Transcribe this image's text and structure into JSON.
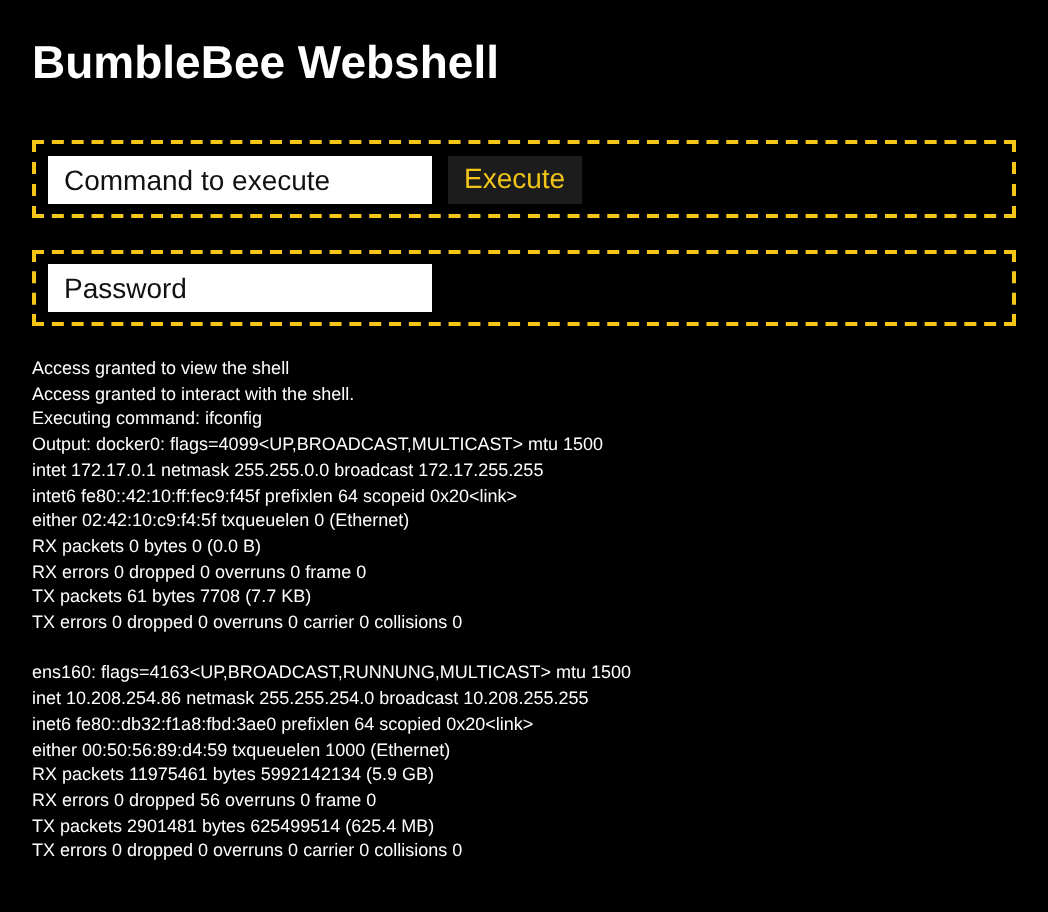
{
  "title": "BumbleBee Webshell",
  "command_form": {
    "input": {
      "placeholder": "Command to execute"
    },
    "button": "Execute"
  },
  "password_form": {
    "input": {
      "placeholder": "Password"
    }
  },
  "output": [
    [
      "Access granted to view the shell",
      "Access granted to interact with the shell.",
      "Executing command: ifconfig",
      "Output: docker0: flags=4099<UP,BROADCAST,MULTICAST> mtu 1500",
      "intet 172.17.0.1 netmask 255.255.0.0 broadcast 172.17.255.255",
      "intet6 fe80::42:10:ff:fec9:f45f prefixlen 64 scopeid 0x20<link>",
      "either 02:42:10:c9:f4:5f txqueuelen 0 (Ethernet)",
      "RX packets 0 bytes 0 (0.0 B)",
      "RX errors 0 dropped 0 overruns 0 frame 0",
      "TX packets 61 bytes 7708 (7.7 KB)",
      "TX errors 0 dropped 0 overruns 0 carrier 0 collisions 0"
    ],
    [
      "ens160: flags=4163<UP,BROADCAST,RUNNUNG,MULTICAST> mtu 1500",
      "inet 10.208.254.86 netmask 255.255.254.0 broadcast 10.208.255.255",
      "inet6 fe80::db32:f1a8:fbd:3ae0 prefixlen 64 scopied 0x20<link>",
      "either 00:50:56:89:d4:59 txqueuelen 1000 (Ethernet)",
      "RX packets 11975461 bytes 5992142134 (5.9 GB)",
      "RX errors 0 dropped 56 overruns 0 frame 0",
      "TX packets 2901481 bytes 625499514 (625.4 MB)",
      "TX errors 0 dropped 0 overruns 0 carrier 0 collisions 0"
    ]
  ]
}
